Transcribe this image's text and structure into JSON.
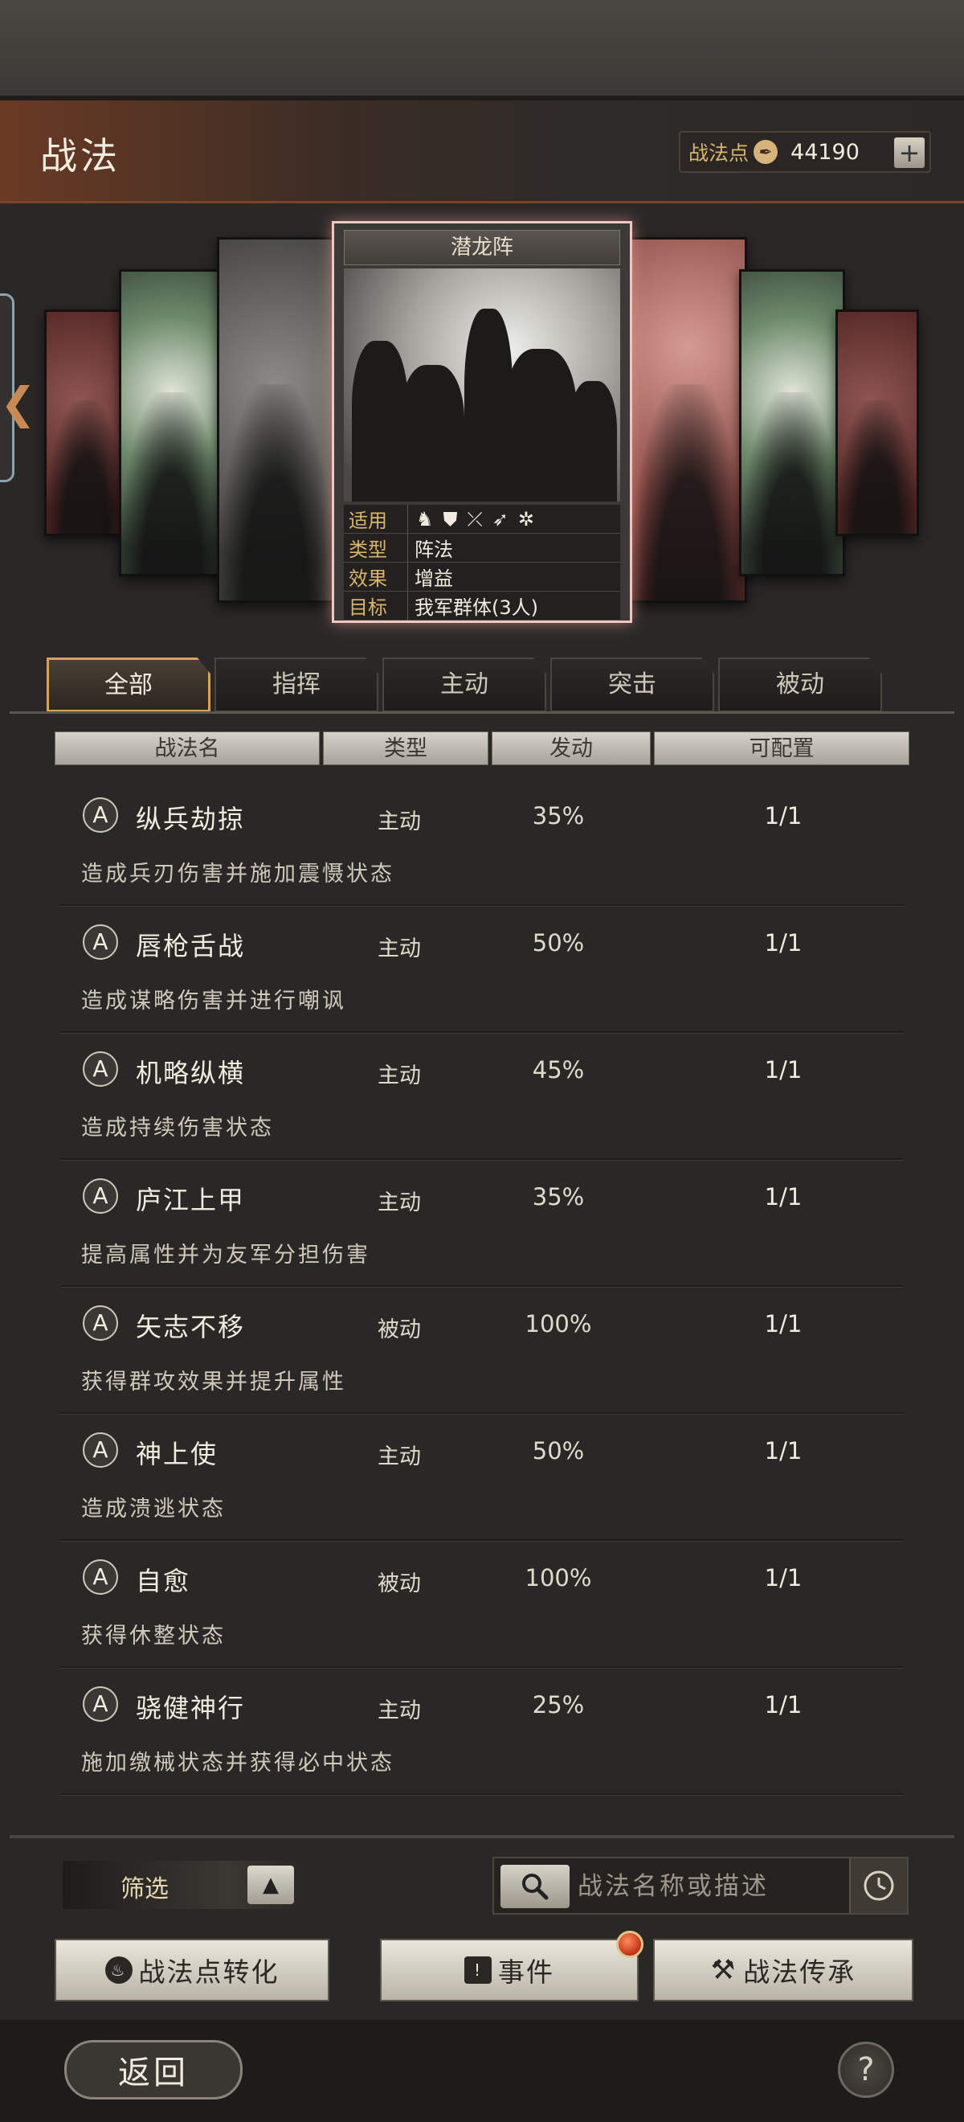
{
  "header": {
    "title": "战法",
    "points_label": "战法点",
    "points_value": "44190",
    "plus_label": "+"
  },
  "featured_card": {
    "title": "潜龙阵",
    "applies_label": "适用",
    "applies_icons": [
      "horse-icon",
      "shield-icon",
      "crossed-bow-icon",
      "spear-icon",
      "wheel-icon"
    ],
    "type_label": "类型",
    "type_value": "阵法",
    "effect_label": "效果",
    "effect_value": "增益",
    "target_label": "目标",
    "target_value": "我军群体(3人)"
  },
  "tabs": [
    {
      "label": "全部",
      "active": true
    },
    {
      "label": "指挥",
      "active": false
    },
    {
      "label": "主动",
      "active": false
    },
    {
      "label": "突击",
      "active": false
    },
    {
      "label": "被动",
      "active": false
    }
  ],
  "columns": [
    "战法名",
    "类型",
    "发动",
    "可配置"
  ],
  "tactics": [
    {
      "badge": "A",
      "name": "纵兵劫掠",
      "type": "主动",
      "rate": "35%",
      "available": "1/1",
      "desc": "造成兵刃伤害并施加震慑状态"
    },
    {
      "badge": "A",
      "name": "唇枪舌战",
      "type": "主动",
      "rate": "50%",
      "available": "1/1",
      "desc": "造成谋略伤害并进行嘲讽"
    },
    {
      "badge": "A",
      "name": "机略纵横",
      "type": "主动",
      "rate": "45%",
      "available": "1/1",
      "desc": "造成持续伤害状态"
    },
    {
      "badge": "A",
      "name": "庐江上甲",
      "type": "主动",
      "rate": "35%",
      "available": "1/1",
      "desc": "提高属性并为友军分担伤害"
    },
    {
      "badge": "A",
      "name": "矢志不移",
      "type": "被动",
      "rate": "100%",
      "available": "1/1",
      "desc": "获得群攻效果并提升属性"
    },
    {
      "badge": "A",
      "name": "神上使",
      "type": "主动",
      "rate": "50%",
      "available": "1/1",
      "desc": "造成溃逃状态"
    },
    {
      "badge": "A",
      "name": "自愈",
      "type": "被动",
      "rate": "100%",
      "available": "1/1",
      "desc": "获得休整状态"
    },
    {
      "badge": "A",
      "name": "骁健神行",
      "type": "主动",
      "rate": "25%",
      "available": "1/1",
      "desc": "施加缴械状态并获得必中状态"
    }
  ],
  "controls": {
    "filter_label": "筛选",
    "search_placeholder": "战法名称或描述",
    "convert_label": "战法点转化",
    "event_label": "事件",
    "inherit_label": "战法传承",
    "back_label": "返回",
    "help_label": "?"
  }
}
